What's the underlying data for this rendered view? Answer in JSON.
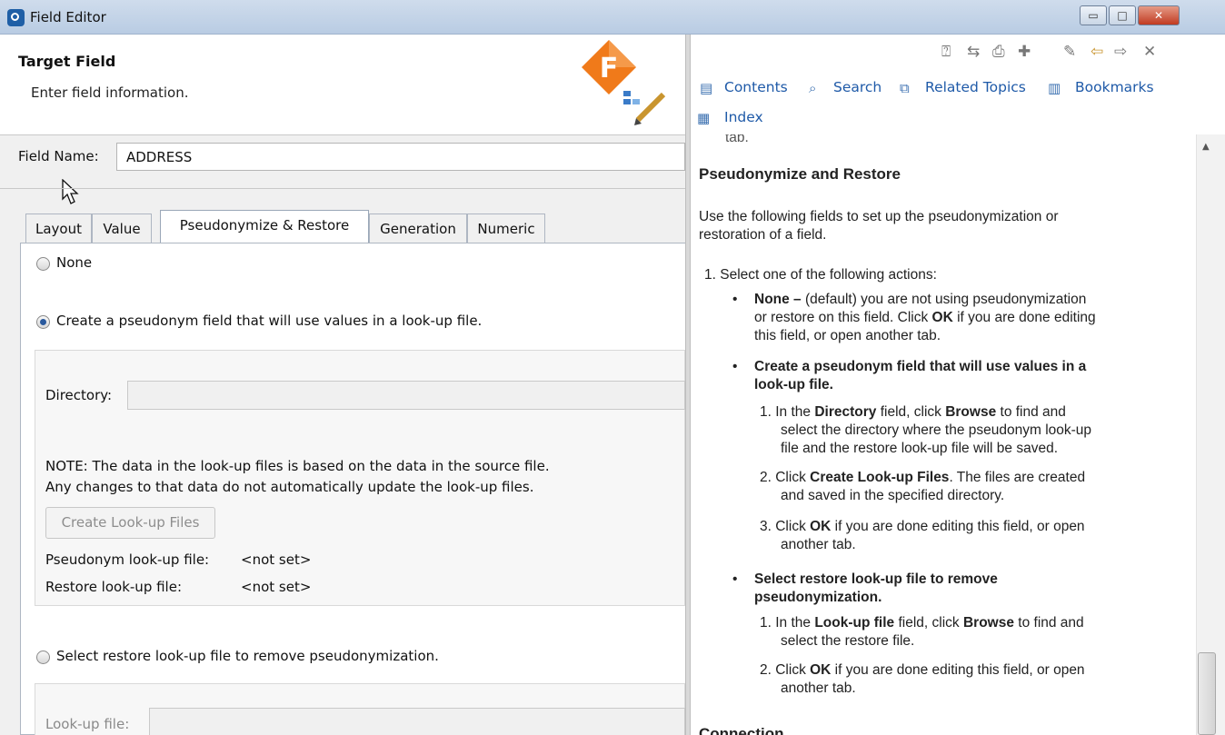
{
  "window": {
    "title": "Field Editor",
    "minimize": "▭",
    "maximize": "□",
    "close": "✕"
  },
  "header": {
    "title": "Target Field",
    "description": "Enter field information.",
    "logo_letter": "F"
  },
  "field_name": {
    "label": "Field Name:",
    "value": "ADDRESS"
  },
  "tabs": [
    "Layout",
    "Value",
    "Pseudonymize & Restore",
    "Generation",
    "Numeric"
  ],
  "options": {
    "none": "None",
    "create": "Create a pseudonym field that will use values in a look-up file.",
    "restore": "Select restore look-up file to remove pseudonymization."
  },
  "create_group": {
    "directory_label": "Directory:",
    "directory_value": "",
    "note_line1": "NOTE: The data in the look-up files is based on the data in the source file.",
    "note_line2": "Any changes to that data do not automatically update the look-up files.",
    "create_button": "Create Look-up Files",
    "pseudonym_label": "Pseudonym look-up file:",
    "pseudonym_value": "<not set>",
    "restore_label": "Restore look-up file:",
    "restore_value": "<not set>"
  },
  "restore_group": {
    "lookup_label": "Look-up file:",
    "lookup_value": ""
  },
  "help_nav": {
    "contents": "Contents",
    "search": "Search",
    "related": "Related Topics",
    "bookmarks": "Bookmarks",
    "index": "Index"
  },
  "help_content": {
    "cut_top": "tab.",
    "heading": "Pseudonymize and Restore",
    "intro1": "Use the following fields to set up the pseudonymization or",
    "intro2": "restoration of a field.",
    "step1": "1. Select one of the following actions:",
    "b1_bold": "None –",
    "b1_rest": " (default) you are not using pseudonymization",
    "b1_l2_a": "or restore on this field. Click ",
    "b1_l2_b": "OK",
    "b1_l2_c": " if you are done editing",
    "b1_l3": "this field, or open another tab.",
    "b2_l1": "Create a pseudonym field that will use values in a",
    "b2_l2": "look-up file.",
    "s1_a": "1. In the ",
    "s1_b": "Directory",
    "s1_c": " field, click ",
    "s1_d": "Browse",
    "s1_e": " to find and",
    "s1_l2": "select the directory where the pseudonym look-up",
    "s1_l3": "file and the restore look-up file will be saved.",
    "s2_a": "2. Click ",
    "s2_b": "Create Look-up Files",
    "s2_c": ". The files are created",
    "s2_l2": "and saved in the specified directory.",
    "s3_a": "3. Click ",
    "s3_b": "OK",
    "s3_c": " if you are done editing this field, or open",
    "s3_l2": "another tab.",
    "b3_l1": "Select restore look-up file to remove",
    "b3_l2": "pseudonymization.",
    "r1_a": "1. In the ",
    "r1_b": "Look-up file",
    "r1_c": " field, click ",
    "r1_d": "Browse",
    "r1_e": " to find and",
    "r1_l2": "select the restore file.",
    "r2_a": "2. Click ",
    "r2_b": "OK",
    "r2_c": " if you are done editing this field, or open",
    "r2_l2": "another tab.",
    "cut_bottom": "Connection"
  }
}
